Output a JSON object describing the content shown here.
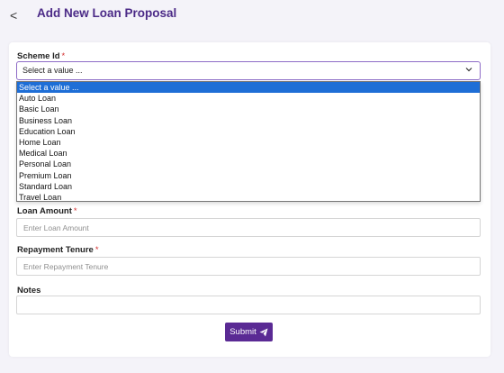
{
  "header": {
    "back_icon": "chevron-left-icon",
    "back_glyph": "<",
    "title": "Add New Loan Proposal"
  },
  "form": {
    "scheme": {
      "label": "Scheme Id",
      "required_mark": "*",
      "selected_value": "Select a value ...",
      "chevron_glyph": "⌄",
      "options": [
        "Select a value ...",
        "Auto Loan",
        "Basic Loan",
        "Business Loan",
        "Education Loan",
        "Home Loan",
        "Medical Loan",
        "Personal Loan",
        "Premium Loan",
        "Standard Loan",
        "Travel Loan"
      ],
      "highlighted_option": "Select a value ..."
    },
    "loan_amount": {
      "label": "Loan Amount",
      "required_mark": "*",
      "placeholder": "Enter Loan Amount",
      "value": ""
    },
    "repayment_tenure": {
      "label": "Repayment Tenure",
      "required_mark": "*",
      "placeholder": "Enter Repayment Tenure",
      "value": ""
    },
    "notes": {
      "label": "Notes",
      "placeholder": "",
      "value": ""
    },
    "submit": {
      "label": "Submit",
      "icon": "paper-plane-icon"
    }
  },
  "colors": {
    "accent": "#4b2a87",
    "button": "#5a2a94",
    "required": "#d32f2f",
    "dropdown_highlight": "#1e6ed6"
  }
}
